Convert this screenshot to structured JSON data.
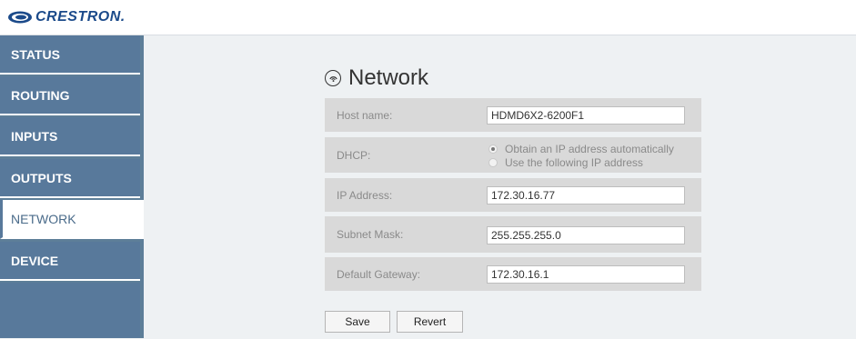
{
  "brand": {
    "name": "CRESTRON."
  },
  "sidebar": {
    "items": [
      {
        "label": "STATUS"
      },
      {
        "label": "ROUTING"
      },
      {
        "label": "INPUTS"
      },
      {
        "label": "OUTPUTS"
      },
      {
        "label": "NETWORK"
      },
      {
        "label": "DEVICE"
      }
    ],
    "active": "NETWORK"
  },
  "main": {
    "title": "Network",
    "title_icon": "network-icon",
    "host_name": {
      "label": "Host name:",
      "value": "HDMD6X2-6200F1"
    },
    "dhcp": {
      "label": "DHCP:",
      "options": [
        {
          "label": "Obtain an IP address automatically",
          "selected": true
        },
        {
          "label": "Use the following IP address",
          "selected": false
        }
      ]
    },
    "ip_address": {
      "label": "IP Address:",
      "value": "172.30.16.77"
    },
    "subnet_mask": {
      "label": "Subnet Mask:",
      "value": "255.255.255.0"
    },
    "default_gateway": {
      "label": "Default Gateway:",
      "value": "172.30.16.1"
    },
    "buttons": {
      "save": "Save",
      "revert": "Revert"
    }
  },
  "colors": {
    "sidebar": "#58799b",
    "brand": "#1b4a8a",
    "row": "#d9d9d9"
  }
}
